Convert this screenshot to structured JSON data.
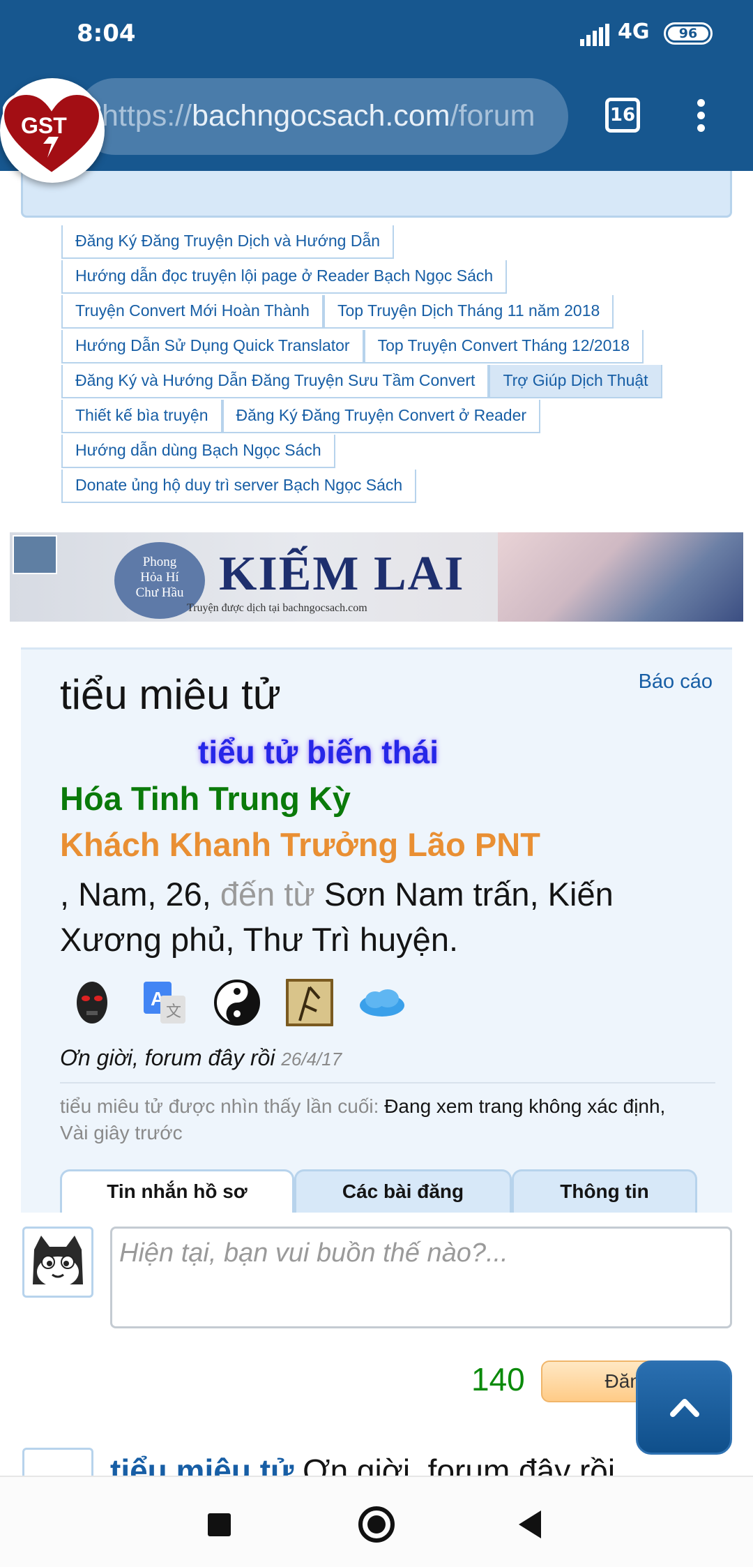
{
  "status_bar": {
    "time": "8:04",
    "network": "4G",
    "battery": "96"
  },
  "browser": {
    "url_scheme": "https://",
    "url_host": "bachngocsach.com",
    "url_path": "/forum",
    "tab_count": "16",
    "gst_label": "GST"
  },
  "nav_links": [
    [
      "Đăng Ký Đăng Truyện Dịch và Hướng Dẫn"
    ],
    [
      "Hướng dẫn đọc truyện lội page ở Reader Bạch Ngọc Sách"
    ],
    [
      "Truyện Convert Mới Hoàn Thành",
      "Top Truyện Dịch Tháng 11 năm 2018"
    ],
    [
      "Hướng Dẫn Sử Dụng Quick Translator",
      "Top Truyện Convert Tháng 12/2018"
    ],
    [
      "Đăng Ký và Hướng Dẫn Đăng Truyện Sưu Tầm Convert",
      "Trợ Giúp Dịch Thuật"
    ],
    [
      "Thiết kế bìa truyện",
      "Đăng Ký Đăng Truyện Convert ở Reader"
    ],
    [
      "Hướng dẫn dùng Bạch Ngọc Sách"
    ],
    [
      "Donate ủng hộ duy trì server Bạch Ngọc Sách"
    ]
  ],
  "banner": {
    "circle_line1": "Phong",
    "circle_line2": "Hỏa Hí",
    "circle_line3": "Chư Hầu",
    "title": "KIẾM LAI",
    "subtitle": "Truyện được dịch tại bachngocsach.com"
  },
  "profile": {
    "report_label": "Báo cáo",
    "username": "tiểu miêu tử",
    "custom_title": "tiểu tử biến thái",
    "rank_primary": "Hóa Tinh Trung Kỳ",
    "rank_secondary": "Khách Khanh Trưởng Lão PNT",
    "info_prefix": ", Nam, 26, ",
    "info_from_label": "đến từ",
    "info_location": " Sơn Nam trấn, Kiến Xương phủ, Thư Trì huyện.",
    "badges": [
      "mask-badge-icon",
      "translate-badge-icon",
      "yin-yang-badge-icon",
      "bamboo-badge-icon",
      "cloud-badge-icon"
    ],
    "motto": "Ơn giời, forum đây rồi",
    "motto_date": "26/4/17",
    "last_seen_label": "tiểu miêu tử được nhìn thấy lần cuối:",
    "last_seen_activity": "Đang xem trang không xác định,",
    "last_seen_time": "Vài giây trước"
  },
  "tabs": [
    "Tin nhắn hồ sơ",
    "Các bài đăng",
    "Thông tin"
  ],
  "composer": {
    "placeholder": "Hiện tại, bạn vui buồn thế nào?...",
    "char_count": "140",
    "post_label": "Đăng"
  },
  "next_post": {
    "author": "tiểu miêu tử",
    "text": " Ơn giời, forum đây rồi"
  },
  "colors": {
    "header_blue": "#17578f",
    "link_blue": "#175ea5",
    "rank_green": "#0a7a0a",
    "rank_orange": "#e98f33",
    "title_blue": "#2626e8"
  }
}
